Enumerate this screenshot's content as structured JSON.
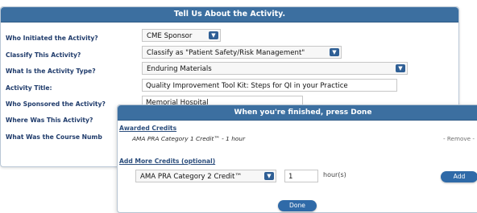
{
  "panel": {
    "title": "Tell Us About the Activity.",
    "rows": [
      {
        "label": "Who Initiated the Activity?",
        "value": "CME Sponsor"
      },
      {
        "label": "Classify This Activity?",
        "value": "Classify as \"Patient Safety/Risk Management\""
      },
      {
        "label": "What Is the Activity Type?",
        "value": "Enduring Materials"
      },
      {
        "label": "Activity Title:",
        "value": "Quality Improvement Tool Kit: Steps for QI in your Practice"
      },
      {
        "label": "Who Sponsored the Activity?",
        "value": "Memorial Hospital"
      },
      {
        "label": "Where Was This Activity?",
        "value": ""
      },
      {
        "label": "What Was the Course Numb",
        "value": ""
      }
    ]
  },
  "modal": {
    "title": "When you're finished, press Done",
    "awarded_heading": "Awarded Credits",
    "awarded_item": "AMA PRA Category 1 Credit™ - 1 hour",
    "remove_label": "- Remove -",
    "add_heading": "Add More Credits (optional)",
    "credit_select": "AMA PRA Category 2 Credit™",
    "hours_value": "1",
    "hours_unit": "hour(s)",
    "add_button": "Add",
    "done_button": "Done"
  },
  "colors": {
    "title_bar": "#3c6fa0",
    "button": "#2f6aa8"
  }
}
